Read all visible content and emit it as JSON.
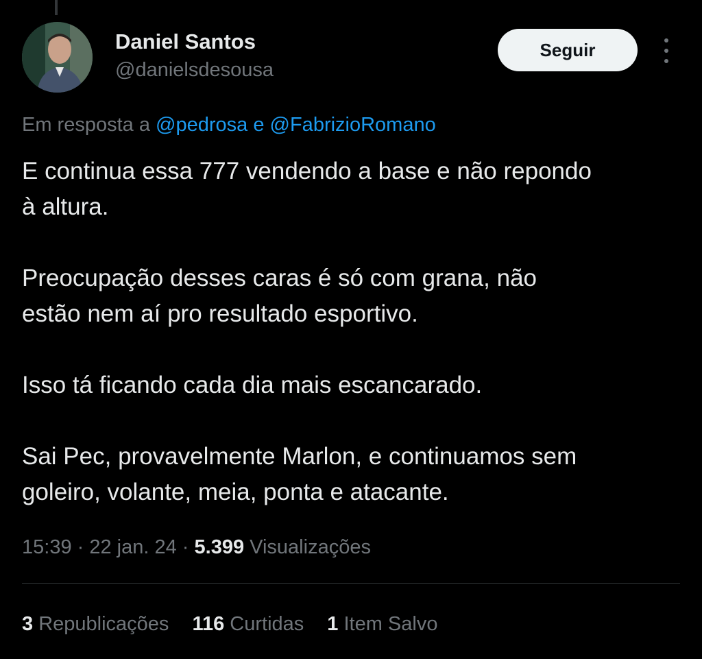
{
  "author": {
    "display_name": "Daniel Santos",
    "handle": "@danielsdesousa"
  },
  "follow_button": {
    "label": "Seguir"
  },
  "reply_to": {
    "prefix": "Em resposta a ",
    "mention_1": "@pedrosa",
    "joiner": " e ",
    "mention_2": "@FabrizioRomano"
  },
  "tweet": {
    "paragraphs": [
      "E continua essa 777 vendendo a base e não repondo\nà altura.",
      "Preocupação desses caras é só com grana, não\nestão nem aí pro resultado esportivo.",
      "Isso tá ficando cada dia mais escancarado.",
      "Sai Pec, provavelmente Marlon, e continuamos sem\ngoleiro, volante, meia, ponta e atacante."
    ]
  },
  "meta": {
    "time": "15:39",
    "sep_1": " · ",
    "date": "22 jan. 24",
    "sep_2": " · ",
    "views_count": "5.399",
    "views_label": " Visualizações"
  },
  "stats": {
    "reposts": {
      "count": "3",
      "label": " Republicações"
    },
    "likes": {
      "count": "116",
      "label": " Curtidas"
    },
    "bookmarks": {
      "count": "1",
      "label": " Item Salvo"
    }
  },
  "colors": {
    "background": "#000000",
    "text_primary": "#e7e9ea",
    "text_secondary": "#71767b",
    "link": "#1d9bf0",
    "button_bg": "#eff3f4"
  },
  "icons": {
    "more": "more-vertical-icon"
  }
}
